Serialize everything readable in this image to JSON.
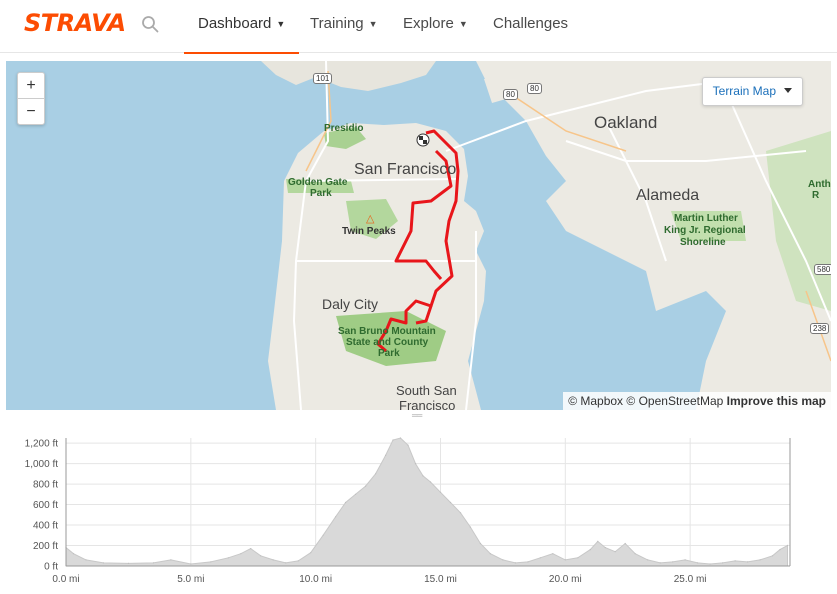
{
  "brand": {
    "logo": "STRAVA",
    "accent": "#fc4c02"
  },
  "nav": {
    "items": [
      {
        "label": "Dashboard",
        "active": true,
        "dropdown": true
      },
      {
        "label": "Training",
        "active": false,
        "dropdown": true
      },
      {
        "label": "Explore",
        "active": false,
        "dropdown": true
      },
      {
        "label": "Challenges",
        "active": false,
        "dropdown": false
      }
    ]
  },
  "map": {
    "zoom_in": "+",
    "zoom_out": "−",
    "layer_selector": "Terrain Map",
    "attribution": {
      "mapbox": "© Mapbox",
      "osm": "© OpenStreetMap",
      "improve": "Improve this map"
    },
    "places": {
      "sf": "San Francisco",
      "oakland": "Oakland",
      "alameda": "Alameda",
      "daly": "Daly City",
      "ssf1": "South San",
      "ssf2": "Francisco",
      "presidio": "Presidio",
      "gg1": "Golden Gate",
      "gg2": "Park",
      "twin": "Twin Peaks",
      "mlk1": "Martin Luther",
      "mlk2": "King Jr. Regional",
      "mlk3": "Shoreline",
      "sb1": "San Bruno Mountain",
      "sb2": "State and County",
      "sb3": "Park",
      "anth1": "Anth",
      "anth2": "R"
    },
    "highways": [
      "101",
      "80",
      "80",
      "580",
      "238"
    ],
    "route_color": "#e8161b"
  },
  "chart_data": {
    "type": "area",
    "title": "",
    "xlabel": "",
    "ylabel": "",
    "x_unit": "mi",
    "y_unit": "ft",
    "xlim": [
      0,
      29
    ],
    "ylim": [
      0,
      1250
    ],
    "x_ticks": [
      "0.0 mi",
      "5.0 mi",
      "10.0 mi",
      "15.0 mi",
      "20.0 mi",
      "25.0 mi"
    ],
    "y_ticks": [
      "0 ft",
      "200 ft",
      "400 ft",
      "600 ft",
      "800 ft",
      "1,000 ft",
      "1,200 ft"
    ],
    "grid": true,
    "fill_color": "#d9d9d9",
    "x": [
      0,
      0.3,
      0.8,
      1.5,
      2.5,
      3.5,
      4.2,
      5.0,
      5.8,
      6.5,
      7.0,
      7.4,
      7.8,
      8.3,
      8.8,
      9.3,
      9.8,
      10.3,
      10.8,
      11.2,
      11.6,
      12.0,
      12.4,
      12.8,
      13.1,
      13.4,
      13.7,
      14.0,
      14.3,
      14.6,
      15.0,
      15.4,
      15.8,
      16.2,
      16.6,
      17.0,
      17.5,
      18.0,
      18.5,
      19.0,
      19.5,
      20.0,
      20.5,
      21.0,
      21.3,
      21.6,
      22.0,
      22.4,
      22.8,
      23.3,
      23.8,
      24.3,
      24.8,
      25.3,
      25.8,
      26.3,
      26.8,
      27.3,
      27.8,
      28.3,
      28.6,
      28.9
    ],
    "y": [
      180,
      120,
      60,
      30,
      25,
      30,
      60,
      20,
      40,
      80,
      120,
      170,
      100,
      60,
      30,
      50,
      130,
      300,
      480,
      620,
      700,
      780,
      900,
      1080,
      1230,
      1250,
      1180,
      1000,
      880,
      820,
      720,
      620,
      520,
      380,
      220,
      120,
      60,
      30,
      40,
      80,
      120,
      60,
      80,
      160,
      240,
      180,
      140,
      220,
      120,
      60,
      30,
      40,
      60,
      30,
      20,
      30,
      50,
      40,
      60,
      100,
      160,
      200
    ]
  }
}
